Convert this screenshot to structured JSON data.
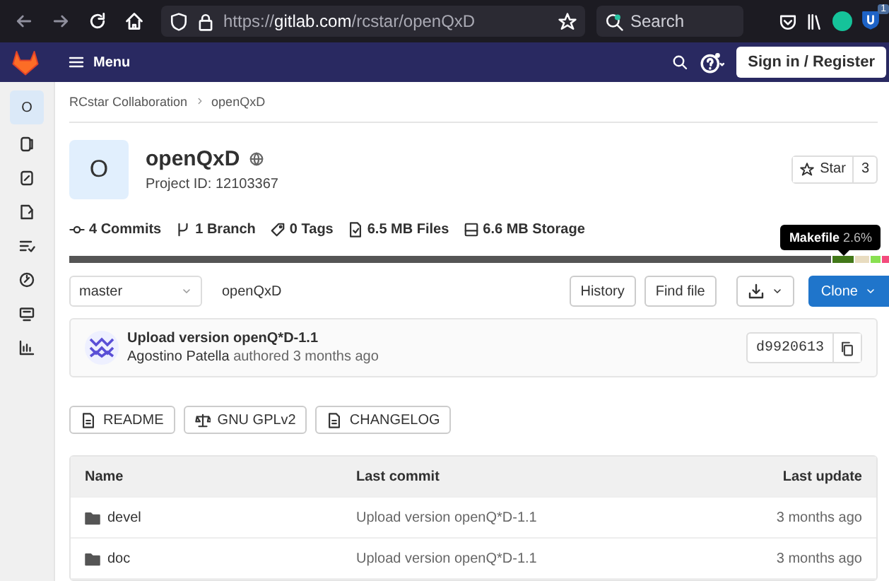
{
  "browser": {
    "url": "https://**gitlab.com**/rcstar/openQxD",
    "search_placeholder": "Search",
    "extension_badge": "1"
  },
  "navbar": {
    "menu_label": "Menu",
    "sign_in": "Sign in / Register"
  },
  "sidebar": {
    "items": [
      {
        "label": "O",
        "selected": true
      },
      {
        "selected": false
      },
      {
        "selected": false
      },
      {
        "selected": false
      },
      {
        "selected": false
      },
      {
        "selected": false
      },
      {
        "selected": false
      },
      {
        "selected": false
      }
    ]
  },
  "breadcrumb": [
    "RCstar Collaboration",
    "openQxD"
  ],
  "project": {
    "avatar": "O",
    "name": "openQxD",
    "id_text": "Project ID: 12103367",
    "star_label": "Star",
    "star_count": "3"
  },
  "stats": [
    {
      "kind": "commits",
      "label": "4 Commits"
    },
    {
      "kind": "branch",
      "label": "1 Branch"
    },
    {
      "kind": "tags",
      "label": "0 Tags"
    },
    {
      "kind": "files",
      "label": "6.5 MB Files"
    },
    {
      "kind": "storage",
      "label": "6.6 MB Storage"
    }
  ],
  "languages": {
    "segments": [
      {
        "color": "#555555"
      },
      {
        "color": "#427819"
      },
      {
        "color": "#e8dcc0"
      },
      {
        "color": "#89e051"
      },
      {
        "color": "#f34b7d"
      }
    ],
    "tooltip": {
      "name": "Makefile",
      "percent": "2.6%"
    }
  },
  "branch_select": {
    "value": "master"
  },
  "path": "openQxD",
  "buttons": [
    "History",
    "Find file"
  ],
  "clone": "Clone",
  "commit": {
    "title": "Upload version openQ*D-1.1",
    "author": "Agostino Patella",
    "meta": "authored 3 months ago",
    "sha": "d9920613"
  },
  "docs": [
    {
      "kind": "readme",
      "label": "README"
    },
    {
      "kind": "license",
      "label": "GNU GPLv2"
    },
    {
      "kind": "changelog",
      "label": "CHANGELOG"
    }
  ],
  "table": {
    "columns": [
      "Name",
      "Last commit",
      "Last update"
    ],
    "rows": [
      {
        "name": "devel",
        "commit": "Upload version openQ*D-1.1",
        "updated": "3 months ago"
      },
      {
        "name": "doc",
        "commit": "Upload version openQ*D-1.1",
        "updated": "3 months ago"
      }
    ]
  }
}
